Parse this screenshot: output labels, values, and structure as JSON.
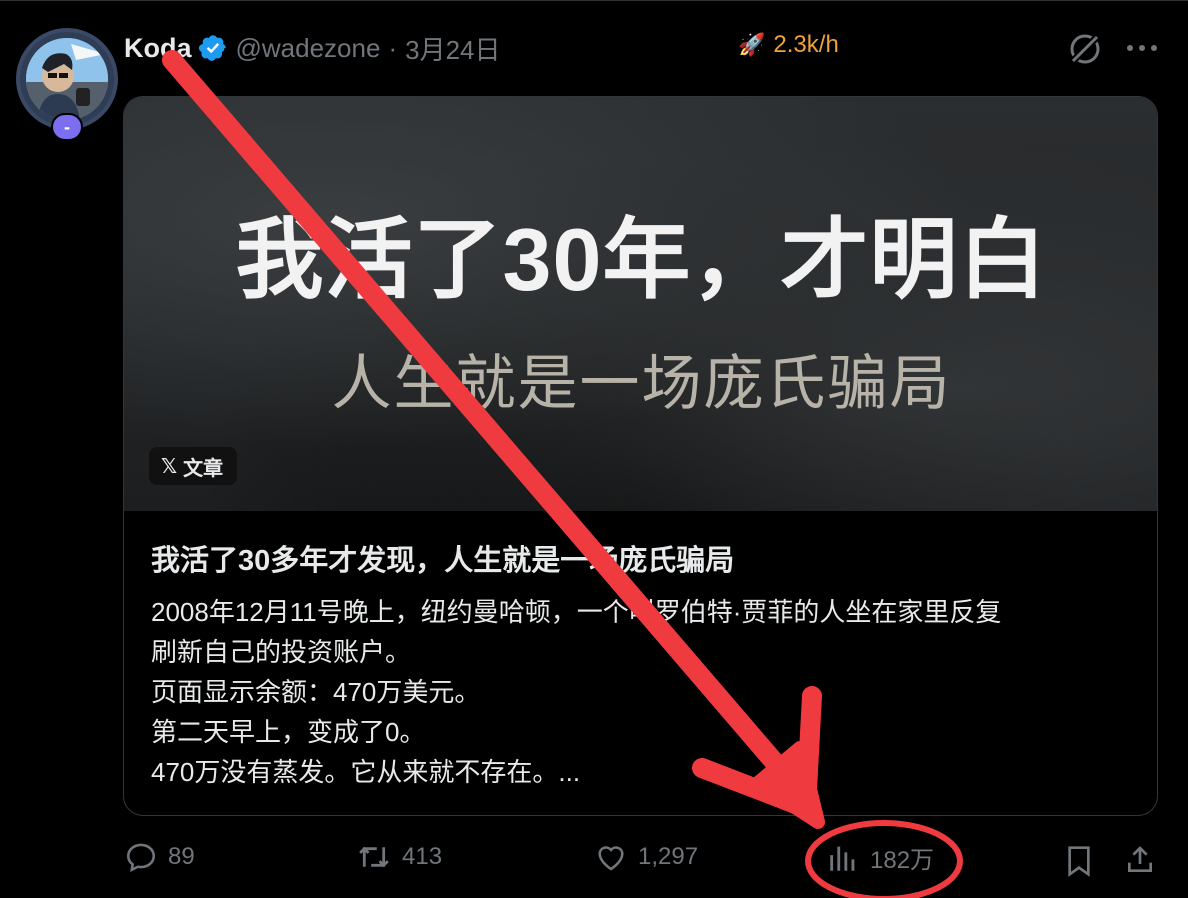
{
  "author": {
    "display_name": "Koda",
    "handle": "@wadezone",
    "separator": "·",
    "date": "3月24日",
    "badge": "-",
    "verified": true
  },
  "rate": {
    "icon": "rocket-icon",
    "value": "2.3k/h"
  },
  "article": {
    "hero_title": "我活了30年，才明白",
    "hero_subtitle": "人生就是一场庞氏骗局",
    "tag_logo": "𝕏",
    "tag_label": "文章",
    "title": "我活了30多年才发现，人生就是一场庞氏骗局",
    "body_lines": [
      "2008年12月11号晚上，纽约曼哈顿，一个叫罗伯特·贾菲的人坐在家里反复",
      "刷新自己的投资账户。",
      "页面显示余额：470万美元。",
      "第二天早上，变成了0。",
      "470万没有蒸发。它从来就不存在。..."
    ]
  },
  "actions": {
    "replies": "89",
    "retweets": "413",
    "likes": "1,297",
    "views": "182万"
  },
  "colors": {
    "background": "#000000",
    "text": "#e7e9ea",
    "muted": "#71767b",
    "verified_blue": "#1d9bf0",
    "rate_orange": "#f0a13a",
    "annotation_red": "#ef3b3f"
  }
}
